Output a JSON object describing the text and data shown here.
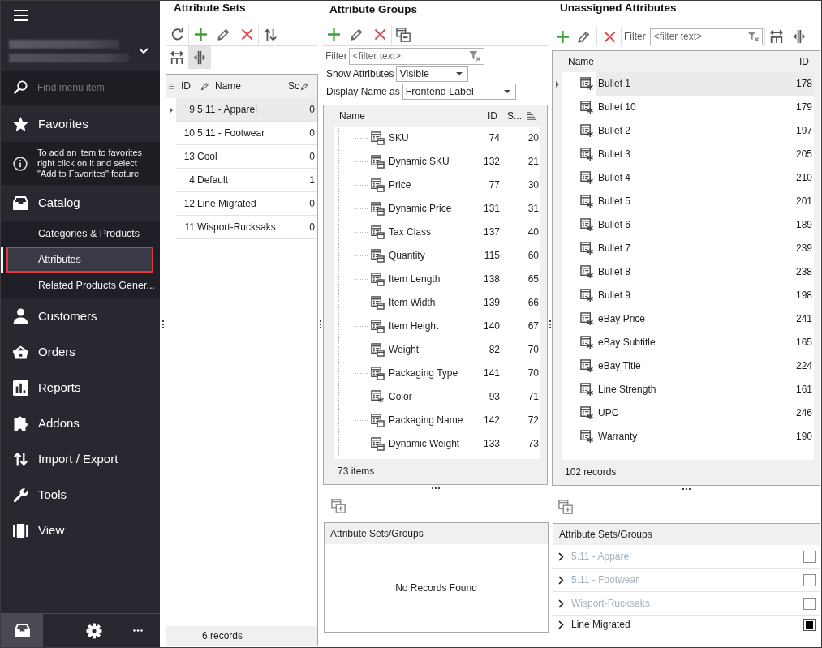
{
  "sidebar": {
    "search": {
      "placeholder": "Find menu item"
    },
    "favorites": {
      "label": "Favorites",
      "hint": "To add an item to favorites right click on it and select \"Add to Favorites\" feature"
    },
    "menu": [
      {
        "label": "Catalog",
        "children": [
          {
            "label": "Categories & Products",
            "selected": false
          },
          {
            "label": "Attributes",
            "selected": true
          },
          {
            "label": "Related Products Gener...",
            "selected": false
          }
        ]
      },
      {
        "label": "Customers"
      },
      {
        "label": "Orders"
      },
      {
        "label": "Reports"
      },
      {
        "label": "Addons"
      },
      {
        "label": "Import / Export"
      },
      {
        "label": "Tools"
      },
      {
        "label": "View"
      }
    ],
    "footer_buttons": [
      {
        "selected": true
      },
      {
        "selected": false
      },
      {
        "selected": false
      }
    ]
  },
  "attribute_sets": {
    "title": "Attribute Sets",
    "view_toggles": [
      {
        "on": false
      },
      {
        "on": true
      }
    ],
    "columns": [
      {
        "label": "ID",
        "editable": true
      },
      {
        "label": "Name",
        "editable": false
      },
      {
        "label": "Sc",
        "editable": true
      }
    ],
    "rows": [
      {
        "cells": [
          "9",
          "5.11 - Apparel",
          "0"
        ],
        "selected": true
      },
      {
        "cells": [
          "10",
          "5.11 - Footwear",
          "0"
        ],
        "selected": false
      },
      {
        "cells": [
          "13",
          "Cool",
          "0"
        ],
        "selected": false
      },
      {
        "cells": [
          "4",
          "Default",
          "1"
        ],
        "selected": false
      },
      {
        "cells": [
          "12",
          "Line Migrated",
          "0"
        ],
        "selected": false
      },
      {
        "cells": [
          "11",
          "Wisport-Rucksaks",
          "0"
        ],
        "selected": false
      }
    ],
    "footer": "6 records"
  },
  "attribute_groups": {
    "title": "Attribute Groups",
    "filter": {
      "label": "Filter",
      "placeholder": "<filter text>"
    },
    "show_attributes": {
      "label": "Show Attributes",
      "value": "Visible"
    },
    "display_name": {
      "label": "Display Name as",
      "value": "Frontend Label"
    },
    "columns": [
      {
        "label": "Name",
        "sorted": false
      },
      {
        "label": "ID",
        "sorted": false
      },
      {
        "label": "S...",
        "sorted": true
      }
    ],
    "rows": [
      {
        "kind": "system",
        "cells": [
          "SKU",
          "74",
          "20"
        ]
      },
      {
        "kind": "system",
        "cells": [
          "Dynamic SKU",
          "132",
          "21"
        ]
      },
      {
        "kind": "system",
        "cells": [
          "Price",
          "77",
          "30"
        ]
      },
      {
        "kind": "system",
        "cells": [
          "Dynamic Price",
          "131",
          "31"
        ]
      },
      {
        "kind": "system",
        "cells": [
          "Tax Class",
          "137",
          "40"
        ]
      },
      {
        "kind": "system",
        "cells": [
          "Quantity",
          "115",
          "60"
        ]
      },
      {
        "kind": "system",
        "cells": [
          "Item Length",
          "138",
          "65"
        ]
      },
      {
        "kind": "system",
        "cells": [
          "Item Width",
          "139",
          "66"
        ]
      },
      {
        "kind": "system",
        "cells": [
          "Item Height",
          "140",
          "67"
        ]
      },
      {
        "kind": "system",
        "cells": [
          "Weight",
          "82",
          "70"
        ]
      },
      {
        "kind": "system",
        "cells": [
          "Packaging Type",
          "141",
          "70"
        ]
      },
      {
        "kind": "custom",
        "cells": [
          "Color",
          "93",
          "71"
        ]
      },
      {
        "kind": "system",
        "cells": [
          "Packaging Name",
          "142",
          "72"
        ]
      },
      {
        "kind": "system",
        "cells": [
          "Dynamic Weight",
          "133",
          "73"
        ]
      }
    ],
    "footer": "73 items",
    "sets_groups": {
      "header": "Attribute Sets/Groups",
      "empty_text": "No Records Found"
    }
  },
  "unassigned_attributes": {
    "title": "Unassigned Attributes",
    "filter": {
      "label": "Filter",
      "placeholder": "<filter text>"
    },
    "view_toggles": [
      {
        "on": false
      },
      {
        "on": false
      }
    ],
    "columns": [
      "Name",
      "ID"
    ],
    "rows": [
      {
        "kind": "custom",
        "cells": [
          "Bullet 1",
          "178"
        ],
        "selected": true
      },
      {
        "kind": "custom",
        "cells": [
          "Bullet 10",
          "179"
        ],
        "selected": false
      },
      {
        "kind": "custom",
        "cells": [
          "Bullet 2",
          "197"
        ],
        "selected": false
      },
      {
        "kind": "custom",
        "cells": [
          "Bullet 3",
          "205"
        ],
        "selected": false
      },
      {
        "kind": "custom",
        "cells": [
          "Bullet 4",
          "210"
        ],
        "selected": false
      },
      {
        "kind": "custom",
        "cells": [
          "Bullet 5",
          "201"
        ],
        "selected": false
      },
      {
        "kind": "custom",
        "cells": [
          "Bullet 6",
          "189"
        ],
        "selected": false
      },
      {
        "kind": "custom",
        "cells": [
          "Bullet 7",
          "239"
        ],
        "selected": false
      },
      {
        "kind": "custom",
        "cells": [
          "Bullet 8",
          "238"
        ],
        "selected": false
      },
      {
        "kind": "custom",
        "cells": [
          "Bullet 9",
          "198"
        ],
        "selected": false
      },
      {
        "kind": "custom",
        "cells": [
          "eBay Price",
          "241"
        ],
        "selected": false
      },
      {
        "kind": "custom",
        "cells": [
          "eBay Subtitle",
          "165"
        ],
        "selected": false
      },
      {
        "kind": "custom",
        "cells": [
          "eBay Title",
          "224"
        ],
        "selected": false
      },
      {
        "kind": "custom",
        "cells": [
          "Line Strength",
          "161"
        ],
        "selected": false
      },
      {
        "kind": "custom",
        "cells": [
          "UPC",
          "246"
        ],
        "selected": false
      },
      {
        "kind": "custom",
        "cells": [
          "Warranty",
          "190"
        ],
        "selected": false
      }
    ],
    "footer": "102 records",
    "sets_groups": {
      "header": "Attribute Sets/Groups",
      "items": [
        {
          "label": "5.11 - Apparel",
          "disabled": true,
          "checked": false
        },
        {
          "label": "5.11 - Footwear",
          "disabled": true,
          "checked": false
        },
        {
          "label": "Wisport-Rucksaks",
          "disabled": true,
          "checked": false
        },
        {
          "label": "Line Migrated",
          "disabled": false,
          "checked": true
        }
      ]
    }
  }
}
